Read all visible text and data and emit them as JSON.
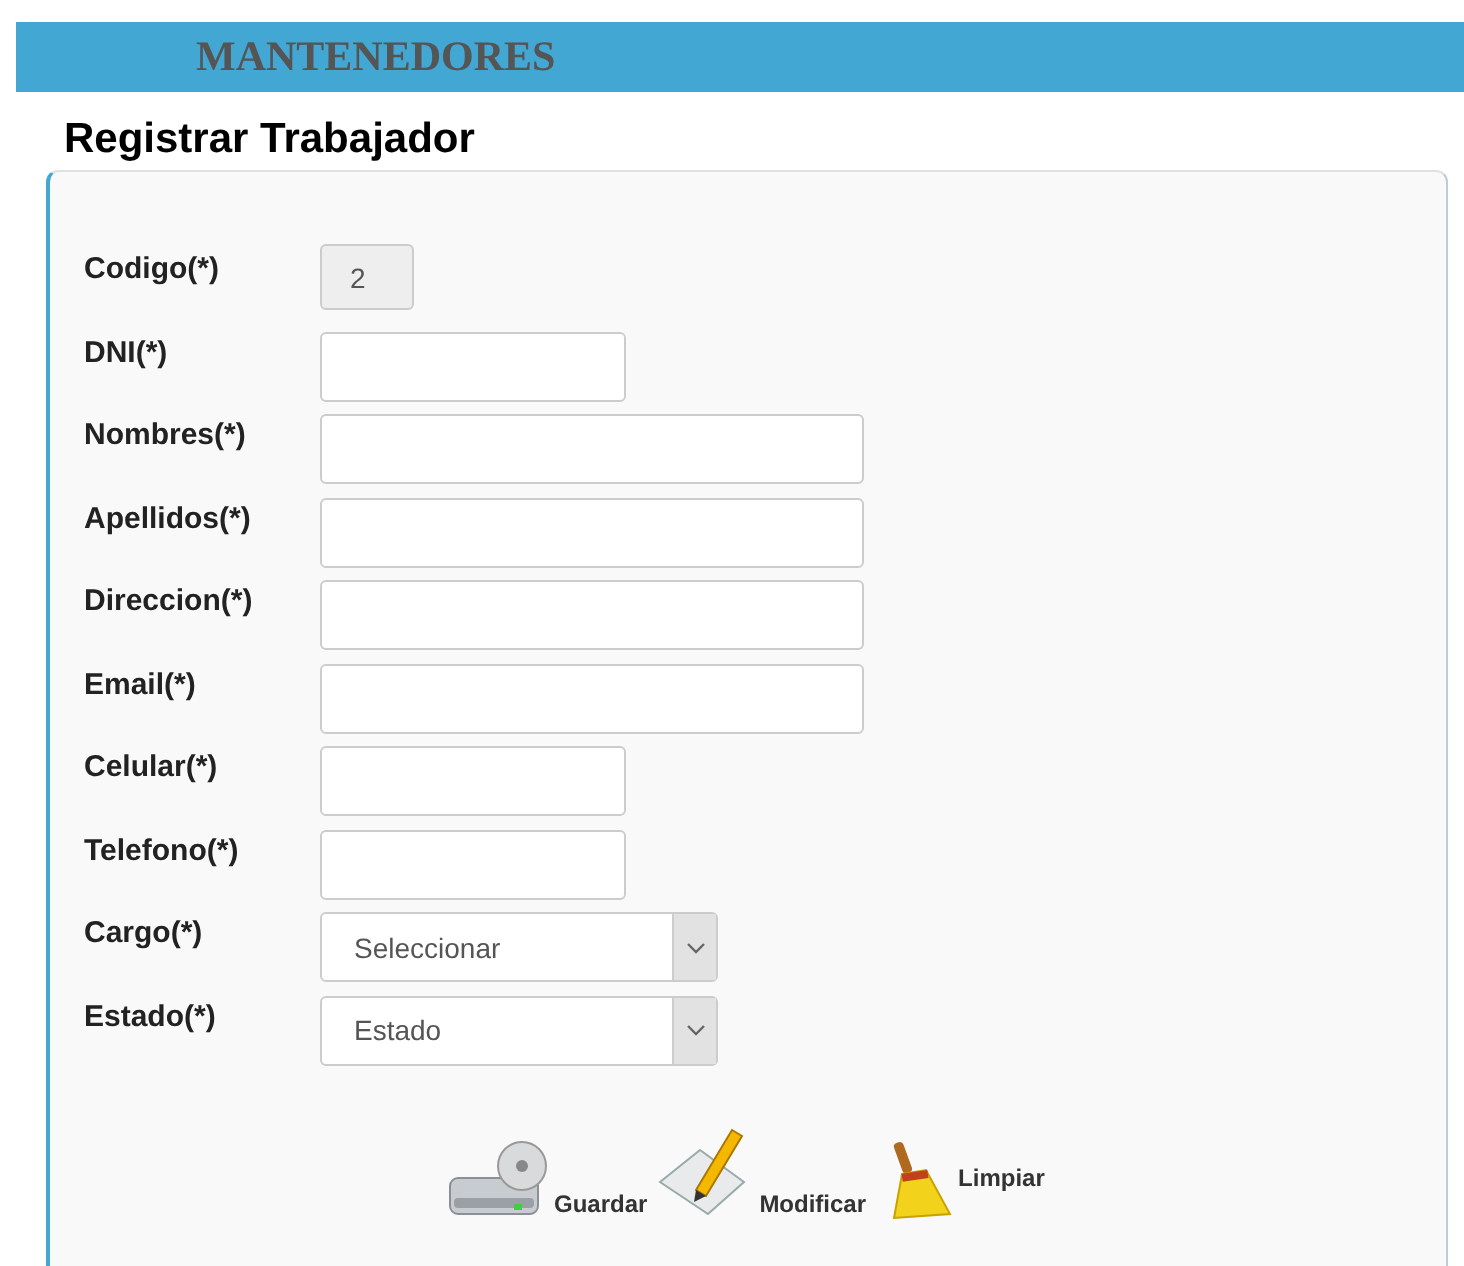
{
  "header": {
    "title": "MANTENEDORES"
  },
  "page_title": "Registrar Trabajador",
  "fields": [
    {
      "label": "Codigo(*)",
      "kind": "code",
      "value": "2",
      "disabled": true
    },
    {
      "label": "DNI(*)",
      "kind": "short",
      "disabled": false
    },
    {
      "label": "Nombres(*)",
      "kind": "long",
      "disabled": false
    },
    {
      "label": "Apellidos(*)",
      "kind": "long",
      "disabled": false
    },
    {
      "label": "Direccion(*)",
      "kind": "long",
      "disabled": false
    },
    {
      "label": "Email(*)",
      "kind": "long",
      "disabled": false
    },
    {
      "label": "Celular(*)",
      "kind": "short",
      "disabled": false
    },
    {
      "label": "Telefono(*)",
      "kind": "short",
      "disabled": false
    },
    {
      "label": "Cargo(*)",
      "kind": "select",
      "value": "Seleccionar",
      "disabled": false
    },
    {
      "label": "Estado(*)",
      "kind": "select",
      "value": "Estado",
      "disabled": false
    }
  ],
  "actions": [
    {
      "label": "Guardar",
      "kind": "save"
    },
    {
      "label": "Modificar",
      "kind": "edit"
    },
    {
      "label": "Limpiar",
      "kind": "clear"
    }
  ]
}
